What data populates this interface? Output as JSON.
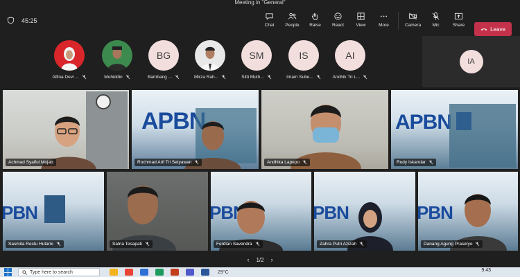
{
  "window": {
    "title": "Meeting in \"General\""
  },
  "toolbar": {
    "timer": "45:25",
    "buttons": [
      {
        "label": "Chat"
      },
      {
        "label": "People"
      },
      {
        "label": "Raise"
      },
      {
        "label": "React"
      },
      {
        "label": "View"
      },
      {
        "label": "More"
      }
    ],
    "device_buttons": [
      {
        "label": "Camera"
      },
      {
        "label": "Mic"
      },
      {
        "label": "Share"
      }
    ],
    "leave_label": "Leave",
    "leave_color": "#c4314b"
  },
  "participants_strip": [
    {
      "name": "Alfina Devi ...",
      "initials": "",
      "photo_bg": "#d9262b"
    },
    {
      "name": "Muhiddin",
      "initials": "",
      "photo_bg": "#3d8a4e"
    },
    {
      "name": "Bambang ...",
      "initials": "BG"
    },
    {
      "name": "Mirza Rah...",
      "initials": "",
      "photo_bg": "#e8e8e8"
    },
    {
      "name": "Sitti Muth...",
      "initials": "SM"
    },
    {
      "name": "Imam Sube...",
      "initials": "IS"
    },
    {
      "name": "Andhik Tri L...",
      "initials": "AI"
    }
  ],
  "self_tile": {
    "initials": "IA"
  },
  "video_tiles": [
    {
      "name": "Achmad Syaiful Mujab"
    },
    {
      "name": "Rochmad Arif Tri Setyawan"
    },
    {
      "name": "Andhika Lapepo"
    },
    {
      "name": "Rudy Iskandar"
    },
    {
      "name": "Sasmita Restu Hutami"
    },
    {
      "name": "Satria Tesapati"
    },
    {
      "name": "Ferdian Savendra"
    },
    {
      "name": "Zahra Putri Azizah"
    },
    {
      "name": "Danang Agung Prasetyo"
    }
  ],
  "slide_text": {
    "big": "APBN",
    "partial": "PBN"
  },
  "pager": {
    "page": "1/2",
    "prev": "‹",
    "next": "›"
  },
  "taskbar": {
    "search_placeholder": "Type here to search",
    "weather": "29°C",
    "time": "9:43"
  },
  "colors": {
    "accent": "#8d7bd6",
    "background": "#1f1f1f"
  }
}
